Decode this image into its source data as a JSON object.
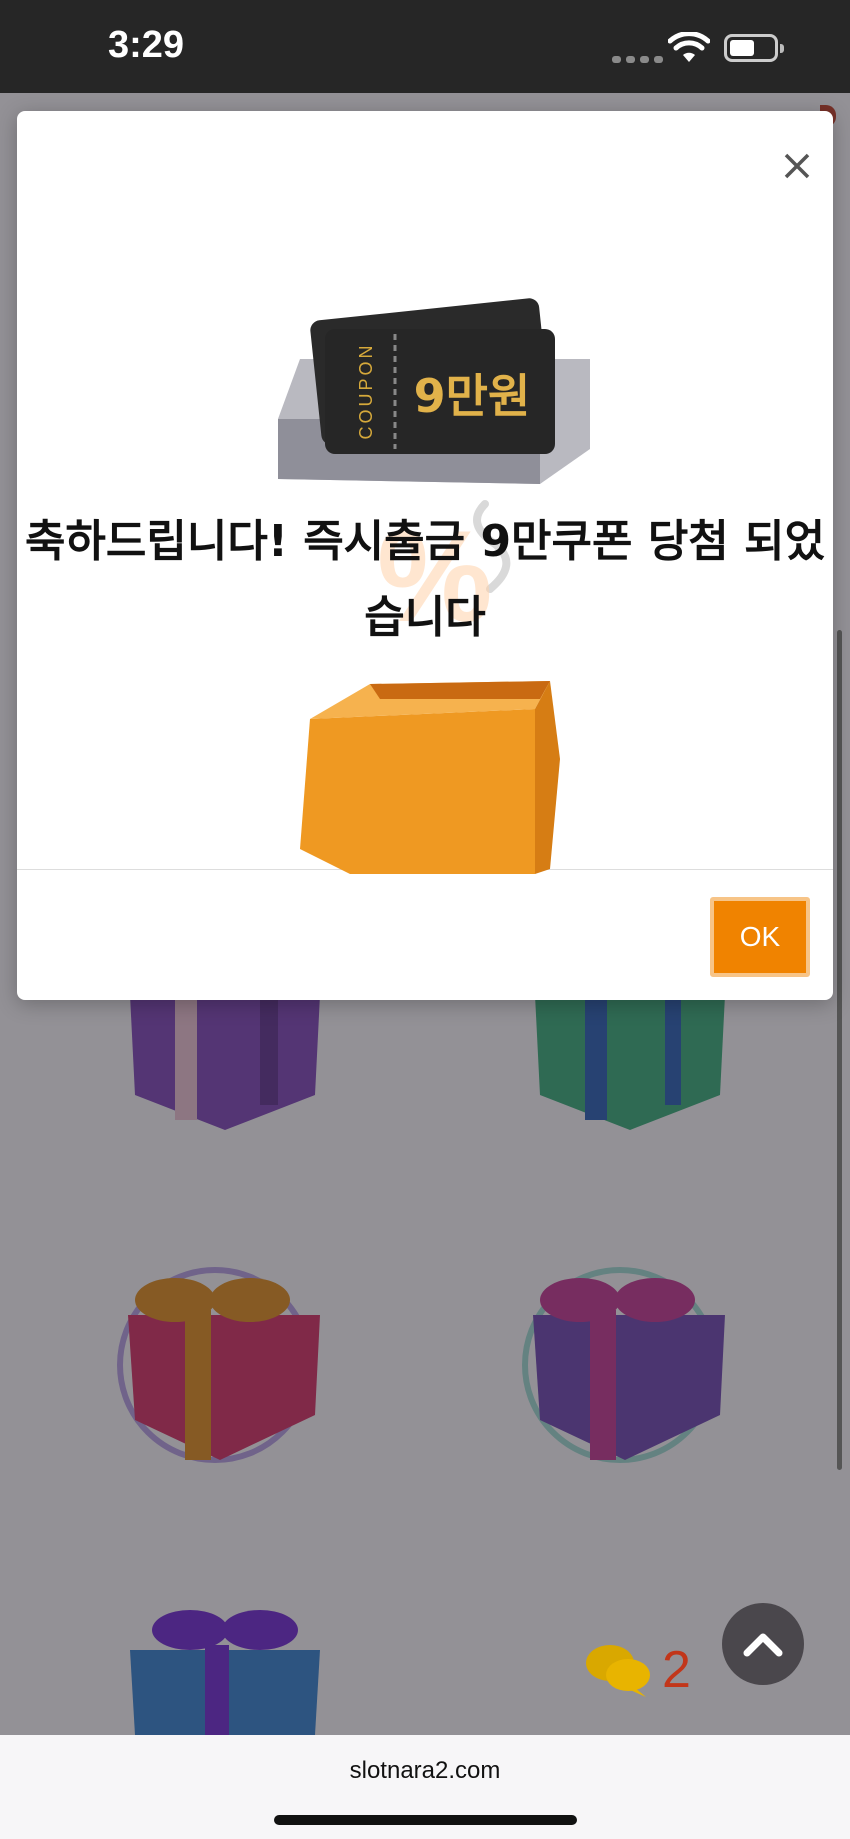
{
  "status_bar": {
    "time": "3:29"
  },
  "modal": {
    "message": "축하드립니다! 즉시출금 9만쿠폰 당첨 되었습니다",
    "coupon_label": "COUPON",
    "coupon_amount": "9만원",
    "ok_label": "OK"
  },
  "background": {
    "chat_count": "2"
  },
  "browser": {
    "url": "slotnara2.com"
  },
  "colors": {
    "accent": "#f08300",
    "dark_bar": "#262626"
  }
}
